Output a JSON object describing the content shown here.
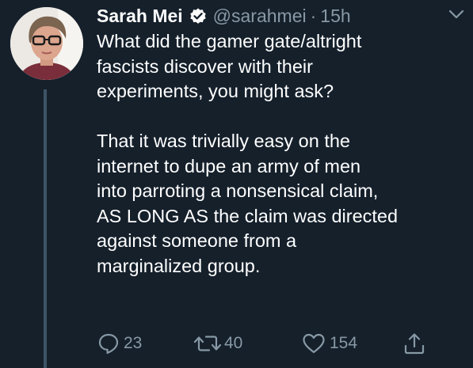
{
  "tweet": {
    "author": {
      "name": "Sarah Mei",
      "handle": "@sarahmei",
      "verified": true
    },
    "separator": "·",
    "time": "15h",
    "text": "What did the gamer gate/altright\nfascists discover with their\nexperiments, you might ask?\n\nThat it was trivially easy on the\ninternet to dupe an army of men\ninto parroting a nonsensical claim,\nAS LONG AS the claim was directed\nagainst someone from a\nmarginalized group.",
    "actions": {
      "reply": {
        "icon": "reply-icon",
        "count": "23"
      },
      "retweet": {
        "icon": "retweet-icon",
        "count": "40"
      },
      "like": {
        "icon": "heart-icon",
        "count": "154"
      },
      "share": {
        "icon": "share-icon"
      }
    }
  },
  "colors": {
    "background": "#15202b",
    "secondary_text": "#8899a6",
    "thread_line": "#3d5466",
    "verified_badge": "#ffffff"
  }
}
